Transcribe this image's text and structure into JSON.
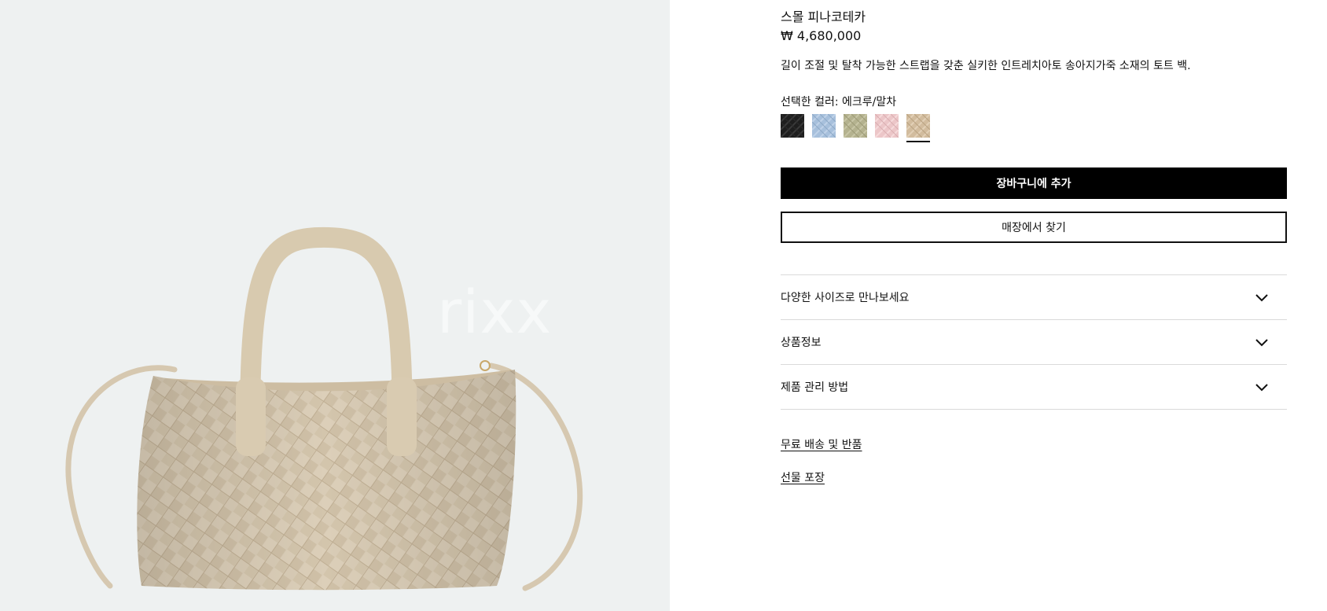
{
  "product": {
    "image_alt": "small cabat bag",
    "watermark": "rixx",
    "title": "스몰 피나코테카",
    "price": "₩ 4,680,000",
    "description": "길이 조절 및 탈착 가능한 스트랩을 갖춘 실키한 인트레치아토 송아지가죽 소재의 토트 백.",
    "color_label": "선택한 컬러:",
    "color_value": "에크루/말차",
    "swatches": [
      {
        "name": "black",
        "color": "#1e1e1e",
        "selected": false
      },
      {
        "name": "light-blue",
        "color": "#a7c0dc",
        "selected": false
      },
      {
        "name": "matcha",
        "color": "#b4b28f",
        "selected": false
      },
      {
        "name": "pink",
        "color": "#ecc6c8",
        "selected": false
      },
      {
        "name": "ecru",
        "color": "#d2bc9e",
        "selected": true
      }
    ]
  },
  "actions": {
    "add_to_cart": "장바구니에 추가",
    "find_in_store": "매장에서 찾기"
  },
  "accordion": [
    {
      "label": "다양한 사이즈로 만나보세요",
      "icon": "chevron-down-icon"
    },
    {
      "label": "상품정보",
      "icon": "chevron-down-icon"
    },
    {
      "label": "제품 관리 방법",
      "icon": "chevron-down-icon"
    }
  ],
  "links": {
    "shipping": "무료 배송 및 반품",
    "gift": "선물 포장"
  },
  "colors": {
    "image_bg": "#eef1f1",
    "bag": "#d9ccb6",
    "primary_button": "#000000",
    "divider": "#dadada"
  }
}
